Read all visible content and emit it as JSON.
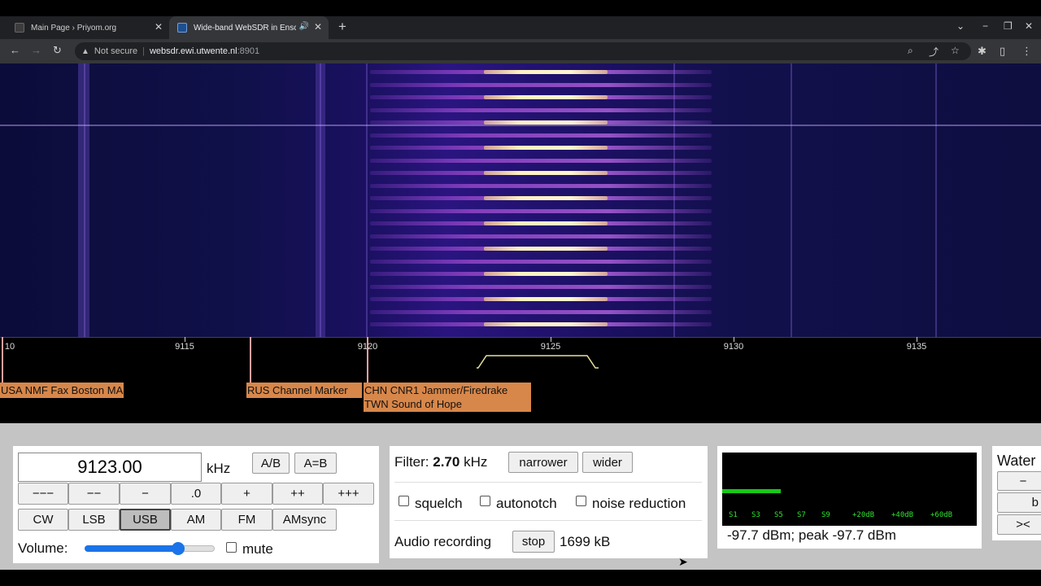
{
  "browser": {
    "tabs": [
      {
        "title": "Main Page › Priyom.org",
        "active": false
      },
      {
        "title": "Wide-band WebSDR in Ensch",
        "active": true
      }
    ],
    "url_host": "websdr.ewi.utwente.nl",
    "url_port": ":8901",
    "security_label": "Not secure"
  },
  "scale": {
    "ticks": [
      "10",
      "9115",
      "9120",
      "9125",
      "9130",
      "9135"
    ]
  },
  "stations": [
    {
      "label": "USA NMF Fax Boston MA"
    },
    {
      "label": "RUS Channel Marker"
    },
    {
      "label": "CHN CNR1 Jammer/Firedrake"
    },
    {
      "label": "TWN Sound of Hope"
    }
  ],
  "freq": {
    "value": "9123.00",
    "unit": "kHz",
    "ab_label": "A/B",
    "aeqb_label": "A=B",
    "steps": [
      "−−−",
      "−−",
      "−",
      ".0",
      "+",
      "++",
      "+++"
    ],
    "modes": [
      "CW",
      "LSB",
      "USB",
      "AM",
      "FM",
      "AMsync"
    ],
    "active_mode": "USB",
    "volume_label": "Volume:",
    "volume_level": 0.72,
    "mute_label": "mute"
  },
  "filter": {
    "label": "Filter:",
    "bandwidth": "2.70",
    "unit": "kHz",
    "narrower_label": "narrower",
    "wider_label": "wider",
    "squelch_label": "squelch",
    "autonotch_label": "autonotch",
    "noise_reduction_label": "noise reduction",
    "recording_label": "Audio recording",
    "stop_label": "stop",
    "recording_size": "1699 kB"
  },
  "meter": {
    "scale_labels": [
      "S1",
      "S3",
      "S5",
      "S7",
      "S9",
      "+20dB",
      "+40dB",
      "+60dB"
    ],
    "level_fraction": 0.23,
    "readout": "-97.7 dBm; peak  -97.7 dBm"
  },
  "waterfall_panel": {
    "title": "Water",
    "minus_label": "−",
    "b_label": "b",
    "swap_label": "><"
  }
}
